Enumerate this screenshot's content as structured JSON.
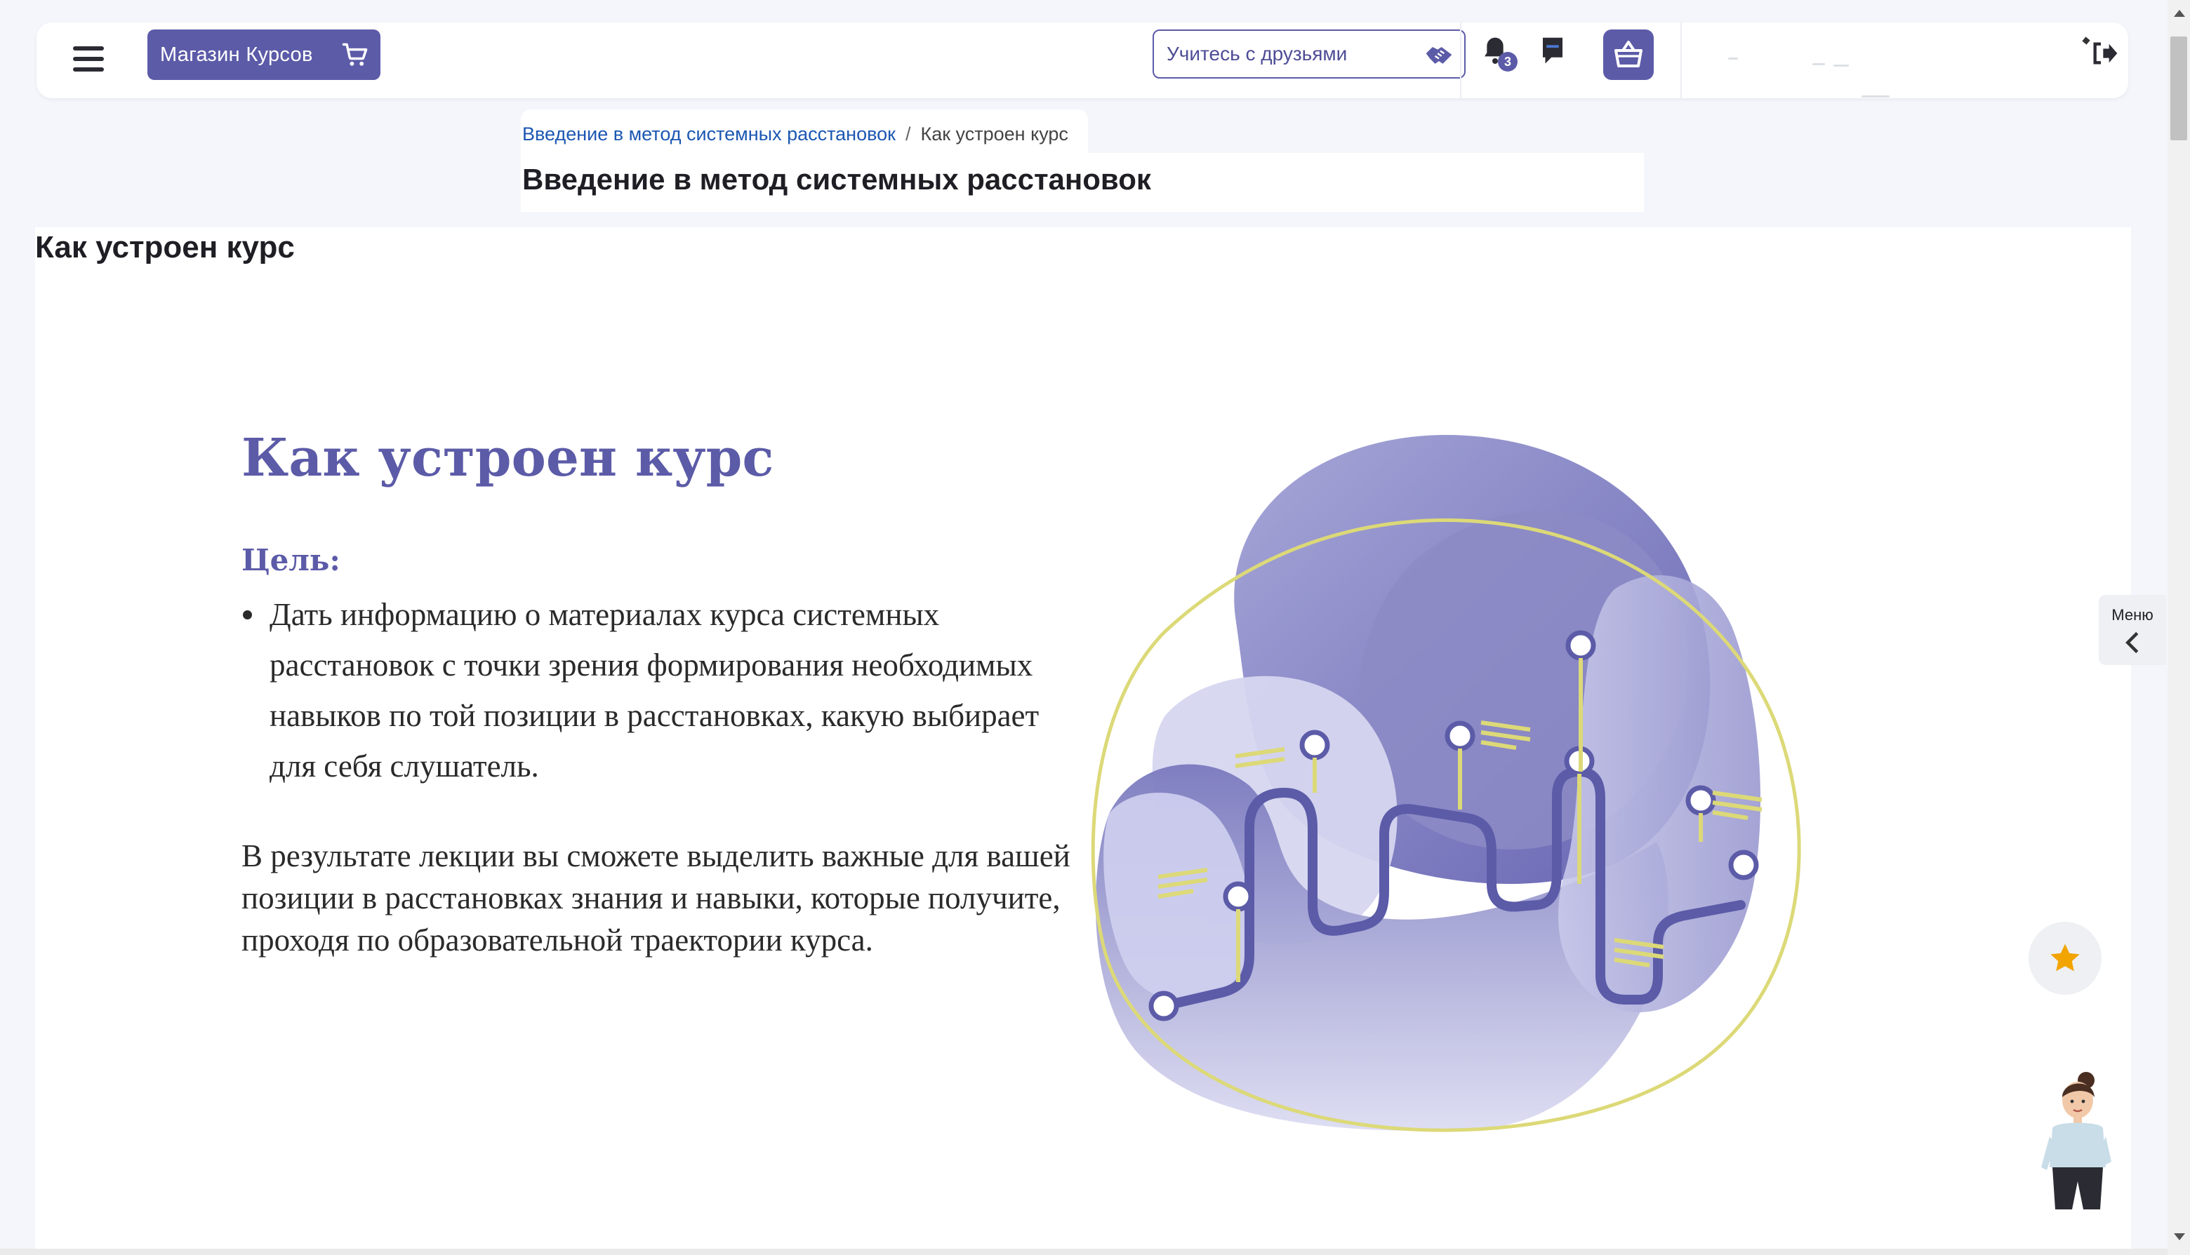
{
  "header": {
    "shop_label": "Магазин Курсов",
    "friends_label": "Учитесь с друзьями",
    "notification_count": "3"
  },
  "breadcrumb": {
    "parent": "Введение в метод системных расстановок",
    "separator": "/",
    "current": "Как устроен курс"
  },
  "course_title": "Введение в метод системных расстановок",
  "section_title": "Как устроен курс",
  "lesson": {
    "heading": "Как устроен курс",
    "goal_label": "Цель:",
    "goal_items": [
      "Дать информацию о материалах курса системных расстановок с точки зрения формирования необходимых навыков по той позиции в расстановках, какую выбирает для себя слушатель."
    ],
    "result_text": "В результате лекции вы сможете выделить важные для вашей позиции в расстановках знания и навыки, которые получите, проходя по образовательной траектории курса."
  },
  "side_menu": {
    "label": "Меню"
  },
  "colors": {
    "brand": "#5c5ba8",
    "link": "#1c57b2",
    "accent_yellow": "#dcd978",
    "star": "#f2a400"
  },
  "icons": [
    "menu-icon",
    "cart-icon",
    "handshake-icon",
    "bell-icon",
    "chat-icon",
    "basket-icon",
    "logout-icon",
    "chevron-left-icon",
    "star-icon"
  ]
}
